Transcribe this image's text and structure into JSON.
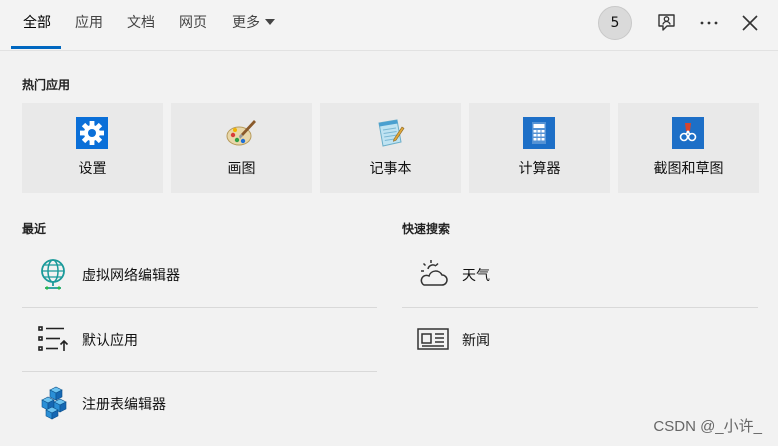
{
  "tabs": [
    {
      "label": "全部",
      "active": true
    },
    {
      "label": "应用"
    },
    {
      "label": "文档"
    },
    {
      "label": "网页"
    },
    {
      "label": "更多"
    }
  ],
  "header": {
    "rewards_count": "5",
    "feedback_icon": "feedback-icon",
    "more_icon": "ellipsis-icon",
    "close_icon": "close-icon"
  },
  "top_apps": {
    "label": "热门应用",
    "items": [
      {
        "label": "设置",
        "icon": "settings-gear-icon"
      },
      {
        "label": "画图",
        "icon": "paint-palette-icon"
      },
      {
        "label": "记事本",
        "icon": "notepad-icon"
      },
      {
        "label": "计算器",
        "icon": "calculator-icon"
      },
      {
        "label": "截图和草图",
        "icon": "snip-sketch-icon"
      }
    ]
  },
  "recent": {
    "label": "最近",
    "items": [
      {
        "label": "虚拟网络编辑器",
        "icon": "globe-network-icon"
      },
      {
        "label": "默认应用",
        "icon": "default-apps-list-icon"
      },
      {
        "label": "注册表编辑器",
        "icon": "registry-cubes-icon"
      }
    ]
  },
  "quick_search": {
    "label": "快速搜索",
    "items": [
      {
        "label": "天气",
        "icon": "weather-cloud-sun-icon"
      },
      {
        "label": "新闻",
        "icon": "newspaper-icon"
      }
    ]
  },
  "watermark": "CSDN @_小许_",
  "colors": {
    "accent": "#0067c0",
    "background": "#f2f2f2",
    "tile": "#e9e9e9"
  }
}
